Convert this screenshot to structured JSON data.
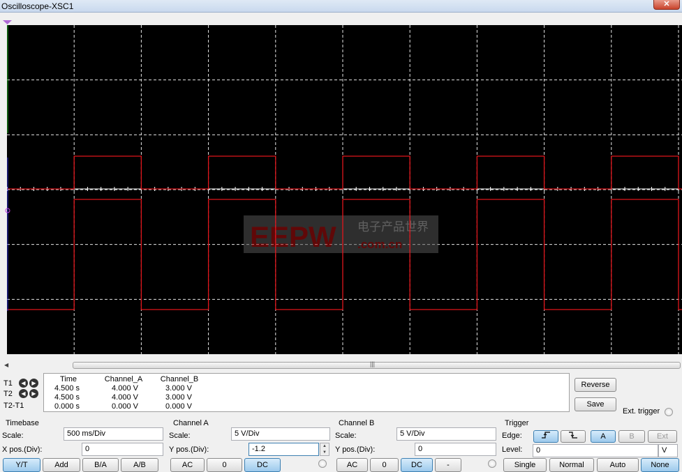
{
  "window": {
    "title": "Oscilloscope-XSC1",
    "close_icon": "close-icon"
  },
  "screen": {
    "background": "#000000",
    "grid_color": "#ffffff",
    "trace_color": "#e0151b",
    "horizontal_divisions": 10,
    "vertical_divisions": 6,
    "watermark": "EEPW 电子产品世界 .com.cn"
  },
  "cursors": {
    "headers": [
      "Time",
      "Channel_A",
      "Channel_B"
    ],
    "rows": [
      {
        "label": "T1",
        "values": [
          "4.500 s",
          "4.000 V",
          "3.000 V"
        ]
      },
      {
        "label": "T2",
        "values": [
          "4.500 s",
          "4.000 V",
          "3.000 V"
        ]
      },
      {
        "label": "T2-T1",
        "values": [
          "0.000 s",
          "0.000 V",
          "0.000 V"
        ]
      }
    ],
    "reverse_label": "Reverse",
    "save_label": "Save",
    "ext_trigger_label": "Ext. trigger"
  },
  "timebase": {
    "title": "Timebase",
    "scale_label": "Scale:",
    "scale_value": "500 ms/Div",
    "xpos_label": "X pos.(Div):",
    "xpos_value": "0",
    "buttons": [
      "Y/T",
      "Add",
      "B/A",
      "A/B"
    ]
  },
  "channel_a": {
    "title": "Channel A",
    "scale_label": "Scale:",
    "scale_value": "5  V/Div",
    "ypos_label": "Y pos.(Div):",
    "ypos_value": "-1.2",
    "buttons": [
      "AC",
      "0",
      "DC"
    ]
  },
  "channel_b": {
    "title": "Channel B",
    "scale_label": "Scale:",
    "scale_value": "5  V/Div",
    "ypos_label": "Y pos.(Div):",
    "ypos_value": "0",
    "buttons": [
      "AC",
      "0",
      "DC",
      "-"
    ]
  },
  "trigger": {
    "title": "Trigger",
    "edge_label": "Edge:",
    "edge_buttons": [
      "rising-edge-icon",
      "falling-edge-icon"
    ],
    "source_buttons": [
      "A",
      "B",
      "Ext"
    ],
    "level_label": "Level:",
    "level_value": "0",
    "level_unit": "V",
    "mode_buttons": [
      "Single",
      "Normal",
      "Auto",
      "None"
    ]
  }
}
